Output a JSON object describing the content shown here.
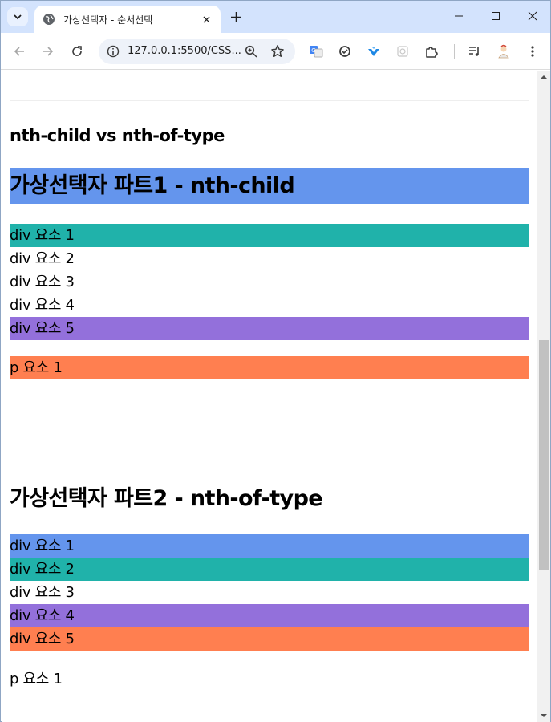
{
  "browser": {
    "tab_title": "가상선택자 - 순서선택",
    "url": "127.0.0.1:5500/CSS...",
    "colors": {
      "tabstrip": "#d3e3fd",
      "omnibox": "#eef2f9"
    },
    "icons": [
      "tab-search-icon",
      "globe-icon",
      "close-icon",
      "plus-icon",
      "minimize-icon",
      "maximize-icon",
      "window-close-icon",
      "back-icon",
      "forward-icon",
      "reload-icon",
      "info-icon",
      "zoom-icon",
      "star-icon",
      "translate-icon",
      "sync-icon",
      "download-icon",
      "extension-icon",
      "puzzle-icon",
      "media-icon",
      "profile-avatar-icon",
      "more-icon"
    ]
  },
  "page": {
    "subtitle": "nth-child vs nth-of-type",
    "part1": {
      "heading": "가상선택자 파트1 - nth-child",
      "heading_bg": "#6495ed",
      "items": [
        {
          "text": "div 요소 1",
          "bg": "#20b2aa"
        },
        {
          "text": "div 요소 2",
          "bg": ""
        },
        {
          "text": "div 요소 3",
          "bg": ""
        },
        {
          "text": "div 요소 4",
          "bg": ""
        },
        {
          "text": "div 요소 5",
          "bg": "#9370db"
        }
      ],
      "p_item": {
        "text": "p 요소 1",
        "bg": "#ff7f50"
      }
    },
    "part2": {
      "heading": "가상선택자 파트2 - nth-of-type",
      "items": [
        {
          "text": "div 요소 1",
          "bg": "#6495ed"
        },
        {
          "text": "div 요소 2",
          "bg": "#20b2aa"
        },
        {
          "text": "div 요소 3",
          "bg": ""
        },
        {
          "text": "div 요소 4",
          "bg": "#9370db"
        },
        {
          "text": "div 요소 5",
          "bg": "#ff7f50"
        }
      ],
      "p_item": {
        "text": "p 요소 1",
        "bg": ""
      }
    }
  }
}
